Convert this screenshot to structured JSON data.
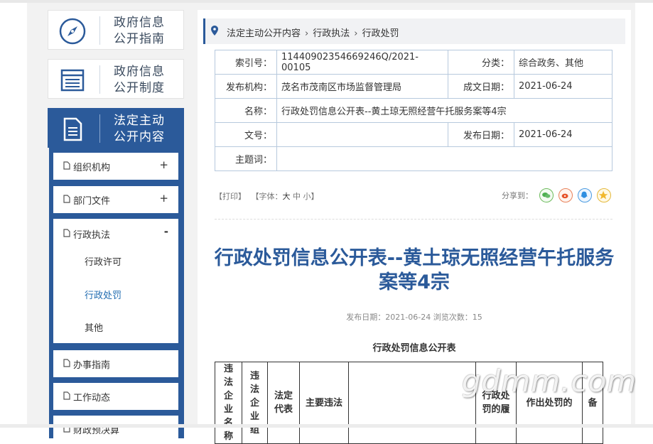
{
  "sidebar": {
    "guides": [
      {
        "label_line1": "政府信息",
        "label_line2": "公开指南",
        "icon": "compass-icon"
      },
      {
        "label_line1": "政府信息",
        "label_line2": "公开制度",
        "icon": "list-doc-icon"
      },
      {
        "label_line1": "法定主动",
        "label_line2": "公开内容",
        "icon": "document-icon"
      }
    ],
    "menu": [
      {
        "label": "组织机构",
        "sign": "+"
      },
      {
        "label": "部门文件",
        "sign": "+"
      },
      {
        "label": "行政执法",
        "sign": "-"
      },
      {
        "label": "办事指南"
      },
      {
        "label": "工作动态"
      },
      {
        "label": "财政预决算"
      }
    ],
    "submenu": [
      "行政许可",
      "行政处罚",
      "其他"
    ]
  },
  "breadcrumb": [
    "法定主动公开内容",
    "行政执法",
    "行政处罚"
  ],
  "meta": {
    "index_label": "索引号：",
    "index_value": "11440902354669246Q/2021-00105",
    "category_label": "分类：",
    "category_value": "综合政务、其他",
    "org_label": "发布机构：",
    "org_value": "茂名市茂南区市场监督管理局",
    "created_label": "成文日期：",
    "created_value": "2021-06-24",
    "name_label": "名称：",
    "name_value": "行政处罚信息公开表--黄土琼无照经营午托服务案等4宗",
    "docno_label": "文号：",
    "docno_value": "",
    "pub_label": "发布日期：",
    "pub_value": "2021-06-24",
    "keyword_label": "主题词：",
    "keyword_value": ""
  },
  "tools": {
    "print": "【打印】",
    "font_prefix": "【字体：",
    "large": "大",
    "medium": "中",
    "small": "小",
    "font_suffix": "】",
    "share_label": "分享到："
  },
  "article": {
    "title": "行政处罚信息公开表--黄土琼无照经营午托服务案等4宗",
    "pubinfo": "发布日期：2021-06-24   浏览次数：15",
    "subtitle": "行政处罚信息公开表"
  },
  "penalty_table": {
    "headers": [
      "违法企业名称",
      "违法企业组",
      "法定代表",
      "主要违法",
      "",
      "行政处罚的履",
      "作出处罚的",
      "备"
    ]
  },
  "watermark": "gdmm.com",
  "colors": {
    "brand": "#2b5a9a",
    "link": "#1f6bb0"
  }
}
